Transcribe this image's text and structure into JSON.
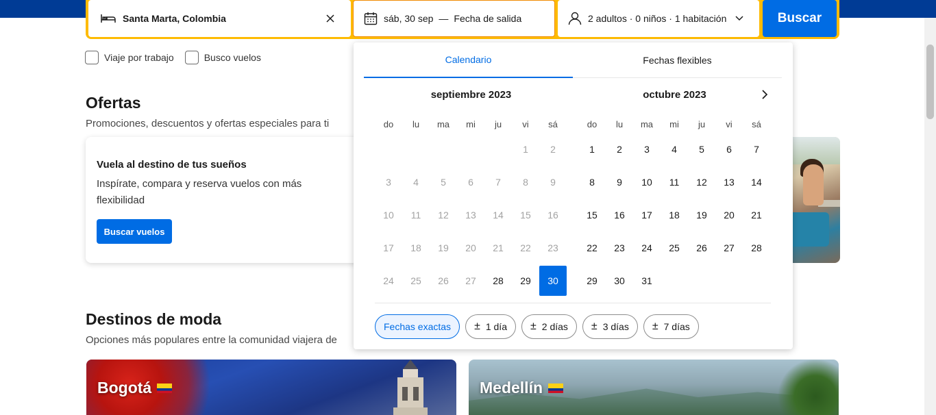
{
  "searchbar": {
    "destination": "Santa Marta, Colombia",
    "checkin": "sáb, 30 sep",
    "dash": "—",
    "checkout_placeholder": "Fecha de salida",
    "guests": "2 adultos · 0 niños · 1 habitación",
    "search_label": "Buscar"
  },
  "options": {
    "business_trip": "Viaje por trabajo",
    "flights": "Busco vuelos"
  },
  "offers": {
    "title": "Ofertas",
    "subtitle": "Promociones, descuentos y ofertas especiales para ti",
    "card": {
      "title": "Vuela al destino de tus sueños",
      "text": "Inspírate, compara y reserva vuelos con más flexibilidad",
      "button": "Buscar vuelos"
    }
  },
  "trending": {
    "title": "Destinos de moda",
    "subtitle": "Opciones más populares entre la comunidad viajera de",
    "cards": [
      {
        "label": "Bogotá"
      },
      {
        "label": "Medellín"
      }
    ]
  },
  "calendar": {
    "tabs": [
      "Calendario",
      "Fechas flexibles"
    ],
    "months": [
      {
        "title": "septiembre 2023",
        "offset": 5,
        "days": 30,
        "past_until": 27,
        "selected": 30
      },
      {
        "title": "octubre 2023",
        "offset": 0,
        "days": 31,
        "past_until": 0,
        "selected": null
      }
    ],
    "weekdays": [
      "do",
      "lu",
      "ma",
      "mi",
      "ju",
      "vi",
      "sá"
    ],
    "flex_options": [
      {
        "label": "Fechas exactas",
        "plusminus": false,
        "active": true
      },
      {
        "label": "1 día",
        "plusminus": true,
        "active": false
      },
      {
        "label": "2 días",
        "plusminus": true,
        "active": false
      },
      {
        "label": "3 días",
        "plusminus": true,
        "active": false
      },
      {
        "label": "7 días",
        "plusminus": true,
        "active": false
      }
    ]
  },
  "colors": {
    "brand_dark": "#003b95",
    "accent": "#006ce4",
    "search_border": "#febb02"
  }
}
